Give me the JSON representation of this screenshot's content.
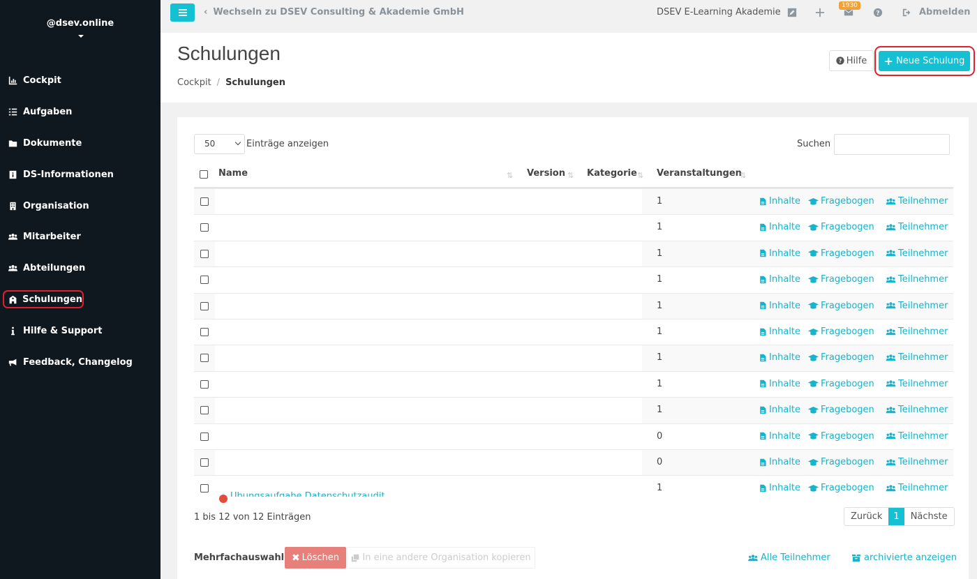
{
  "sidebar": {
    "org": "@dsev.online",
    "items": [
      {
        "label": "Cockpit",
        "icon": "chart-icon"
      },
      {
        "label": "Aufgaben",
        "icon": "tasks-icon"
      },
      {
        "label": "Dokumente",
        "icon": "folder-icon"
      },
      {
        "label": "DS-Informationen",
        "icon": "info-box-icon"
      },
      {
        "label": "Organisation",
        "icon": "building-icon"
      },
      {
        "label": "Mitarbeiter",
        "icon": "users-icon"
      },
      {
        "label": "Abteilungen",
        "icon": "users-icon"
      },
      {
        "label": "Schulungen",
        "icon": "school-icon"
      },
      {
        "label": "Hilfe & Support",
        "icon": "info-icon"
      },
      {
        "label": "Feedback, Changelog",
        "icon": "megaphone-icon"
      }
    ],
    "active_index": 7
  },
  "topbar": {
    "switch_label": "Wechseln zu DSEV Consulting & Akademie GmbH",
    "academy": "DSEV E-Learning Akademie",
    "mail_badge": "1930",
    "logout": "Abmelden"
  },
  "header": {
    "title": "Schulungen",
    "breadcrumb_home": "Cockpit",
    "breadcrumb_current": "Schulungen",
    "help_label": "Hilfe",
    "new_label": "Neue Schulung"
  },
  "table": {
    "page_length": "50",
    "length_label": "Einträge anzeigen",
    "search_label": "Suchen",
    "columns": {
      "name": "Name",
      "version": "Version",
      "category": "Kategorie",
      "events": "Veranstaltungen"
    },
    "action_labels": {
      "contents": "Inhalte",
      "questionnaire": "Fragebogen",
      "participants": "Teilnehmer"
    },
    "rows": [
      {
        "count": "1"
      },
      {
        "count": "1"
      },
      {
        "count": "1"
      },
      {
        "count": "1"
      },
      {
        "count": "1"
      },
      {
        "count": "1"
      },
      {
        "count": "1"
      },
      {
        "count": "1"
      },
      {
        "count": "1"
      },
      {
        "count": "0"
      },
      {
        "count": "0"
      },
      {
        "count": "1",
        "name": "Übungsaufgabe Datenschutzaudit"
      }
    ],
    "info": "1 bis 12 von 12 Einträgen",
    "pager": {
      "prev": "Zurück",
      "current": "1",
      "next": "Nächste"
    }
  },
  "footer": {
    "multi_label": "Mehrfachauswahl:",
    "delete_label": "Löschen",
    "copy_label": "In eine andere Organisation kopieren",
    "all_participants": "Alle Teilnehmer",
    "show_archived": "archivierte anzeigen"
  },
  "colors": {
    "accent": "#14c0d2",
    "sidebar_bg": "#10181f",
    "danger": "#e7807a",
    "highlight": "#e0202b"
  }
}
